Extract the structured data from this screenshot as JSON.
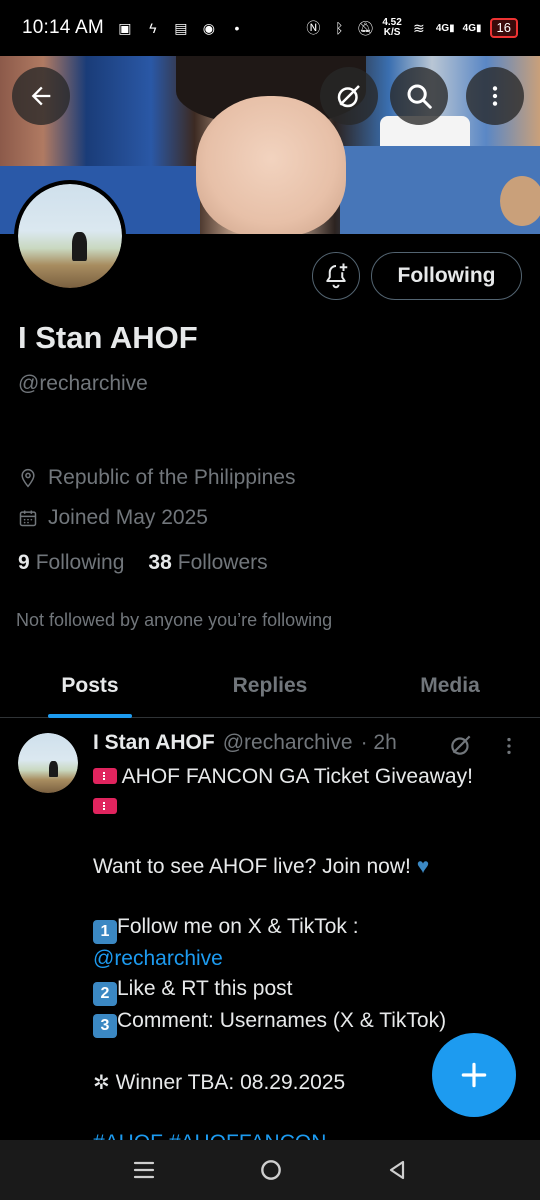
{
  "status_bar": {
    "time": "10:14 AM",
    "net_speed_value": "4.52",
    "net_speed_unit": "K/S",
    "signal_1": "4G",
    "signal_2": "4G",
    "battery": "16"
  },
  "header": {
    "back_icon": "back-arrow-icon",
    "grok_icon": "slash-circle-icon",
    "search_icon": "search-icon",
    "more_icon": "more-vertical-icon"
  },
  "profile": {
    "display_name": "I Stan AHOF",
    "handle": "@recharchive",
    "location": "Republic of the Philippines",
    "joined": "Joined May 2025",
    "following_count": "9",
    "following_label": "Following",
    "followers_count": "38",
    "followers_label": "Followers",
    "not_followed_text": "Not followed by anyone you’re following",
    "follow_button_label": "Following"
  },
  "tabs": [
    {
      "label": "Posts",
      "active": true
    },
    {
      "label": "Replies",
      "active": false
    },
    {
      "label": "Media",
      "active": false
    }
  ],
  "post": {
    "author_name": "I Stan AHOF",
    "author_handle": "@recharchive",
    "time": "· 2h",
    "line1": " AHOF FANCON GA Ticket Giveaway!",
    "line3": "Want to see AHOF live? Join now! ",
    "step1_key": "1",
    "step1": "Follow me on X & TikTok :",
    "step1_link": "@recharchive",
    "step2_key": "2",
    "step2": "Like & RT this post",
    "step3_key": "3",
    "step3": "Comment: Usernames (X & TikTok)",
    "winner": " Winner TBA: 08.29.2025",
    "hashtags": "#AHOF #AHOFFANCON"
  },
  "colors": {
    "accent": "#1d9bf0",
    "background": "#000000",
    "muted_text": "#71767b",
    "primary_text": "#e7e9ea"
  }
}
